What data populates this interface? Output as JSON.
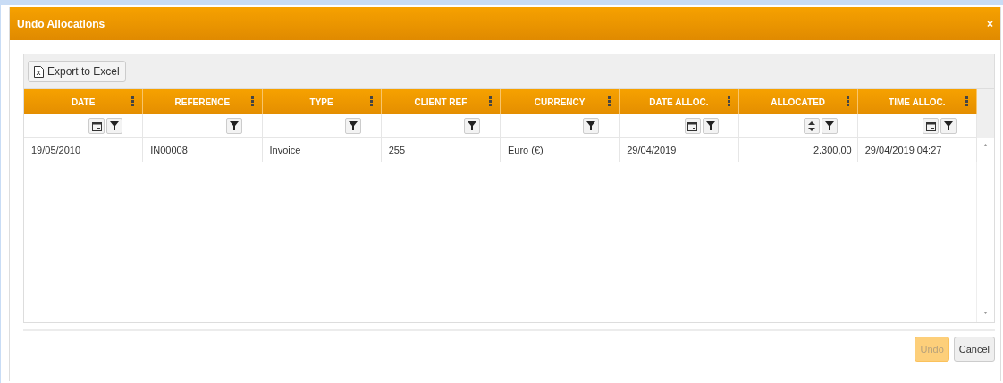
{
  "window": {
    "title": "Undo Allocations",
    "close": "×"
  },
  "toolbar": {
    "export_button": "Export to Excel"
  },
  "table": {
    "columns": [
      {
        "label": "DATE",
        "kind": "date"
      },
      {
        "label": "REFERENCE",
        "kind": "text"
      },
      {
        "label": "TYPE",
        "kind": "text"
      },
      {
        "label": "CLIENT REF",
        "kind": "text"
      },
      {
        "label": "CURRENCY",
        "kind": "text"
      },
      {
        "label": "DATE ALLOC.",
        "kind": "date"
      },
      {
        "label": "ALLOCATED",
        "kind": "number"
      },
      {
        "label": "TIME ALLOC.",
        "kind": "date"
      }
    ],
    "rows": [
      {
        "cells": [
          "19/05/2010",
          "IN00008",
          "Invoice",
          "255",
          "Euro (€)",
          "29/04/2019",
          "2.300,00",
          "29/04/2019 04:27"
        ]
      }
    ]
  },
  "buttons": [
    {
      "label": "Undo",
      "disabled": true
    },
    {
      "label": "Cancel",
      "disabled": false
    }
  ]
}
